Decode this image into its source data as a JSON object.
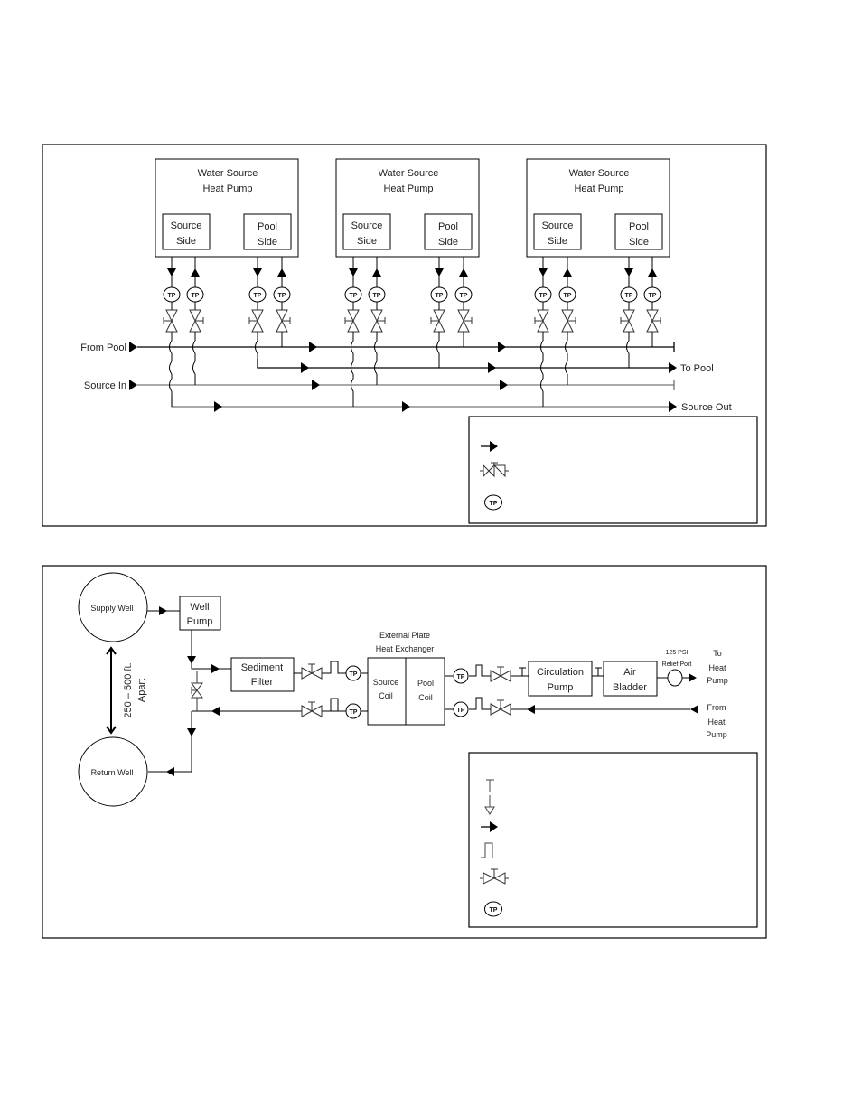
{
  "diagram1": {
    "heat_pumps": [
      {
        "title_line1": "Water Source",
        "title_line2": "Heat Pump",
        "source_line1": "Source",
        "source_line2": "Side",
        "pool_line1": "Pool",
        "pool_line2": "Side"
      },
      {
        "title_line1": "Water Source",
        "title_line2": "Heat Pump",
        "source_line1": "Source",
        "source_line2": "Side",
        "pool_line1": "Pool",
        "pool_line2": "Side"
      },
      {
        "title_line1": "Water Source",
        "title_line2": "Heat Pump",
        "source_line1": "Source",
        "source_line2": "Side",
        "pool_line1": "Pool",
        "pool_line2": "Side"
      }
    ],
    "labels": {
      "from_pool": "From Pool",
      "source_in": "Source In",
      "to_pool": "To Pool",
      "source_out": "Source Out"
    },
    "tp_label": "TP",
    "legend": {
      "symbols": [
        "flow-arrow",
        "ball-valve",
        "temp-pressure-port"
      ],
      "tp_label": "TP"
    }
  },
  "diagram2": {
    "supply_well": "Supply Well",
    "return_well": "Return Well",
    "distance_line1": "250 – 500 ft.",
    "distance_line2": "Apart",
    "well_pump_line1": "Well",
    "well_pump_line2": "Pump",
    "sediment_filter_line1": "Sediment",
    "sediment_filter_line2": "Filter",
    "hx_title_line1": "External Plate",
    "hx_title_line2": "Heat Exchanger",
    "source_coil_line1": "Source",
    "source_coil_line2": "Coil",
    "pool_coil_line1": "Pool",
    "pool_coil_line2": "Coil",
    "circulation_pump_line1": "Circulation",
    "circulation_pump_line2": "Pump",
    "air_bladder_line1": "Air",
    "air_bladder_line2": "Bladder",
    "relief_line1": "125 PSI",
    "relief_line2": "Relief Port",
    "to_hp_line1": "To",
    "to_hp_line2": "Heat",
    "to_hp_line3": "Pump",
    "from_hp_line1": "From",
    "from_hp_line2": "Heat",
    "from_hp_line3": "Pump",
    "tp_label": "TP",
    "legend": {
      "symbols": [
        "isolation-cap",
        "drain",
        "flow-arrow",
        "loop",
        "ball-valve",
        "temp-pressure-port"
      ],
      "tp_label": "TP"
    }
  }
}
